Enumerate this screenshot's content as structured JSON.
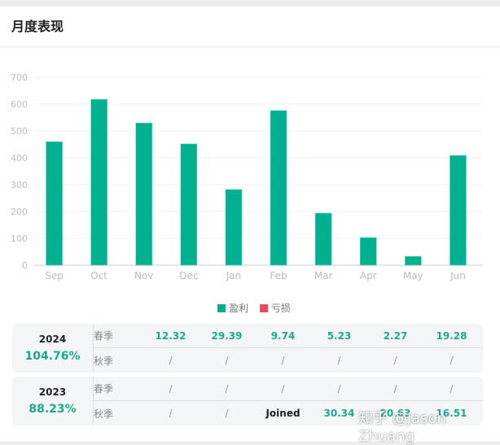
{
  "header": {
    "title": "月度表现"
  },
  "chart_data": {
    "type": "bar",
    "categories": [
      "Sep",
      "Oct",
      "Nov",
      "Dec",
      "Jan",
      "Feb",
      "Mar",
      "Apr",
      "May",
      "Jun"
    ],
    "series": [
      {
        "name": "盈利",
        "color": "#00b08e",
        "values": [
          460,
          618,
          530,
          452,
          282,
          576,
          194,
          103,
          33,
          409
        ]
      },
      {
        "name": "亏损",
        "color": "#e84a5f",
        "values": [
          0,
          0,
          0,
          0,
          0,
          0,
          0,
          0,
          0,
          0
        ]
      }
    ],
    "yticks": [
      "0",
      "100",
      "200",
      "300",
      "400",
      "500",
      "600",
      "700"
    ],
    "ylim": [
      0,
      700
    ],
    "grid": true,
    "legend_position": "bottom"
  },
  "table": [
    {
      "year": "2024",
      "pct": "104.76%",
      "rows": [
        {
          "label": "春季",
          "cells": [
            "12.32",
            "29.39",
            "9.74",
            "5.23",
            "2.27",
            "19.28"
          ]
        },
        {
          "label": "秋季",
          "cells": [
            "/",
            "/",
            "/",
            "/",
            "/",
            "/"
          ]
        }
      ]
    },
    {
      "year": "2023",
      "pct": "88.23%",
      "rows": [
        {
          "label": "春季",
          "cells": [
            "/",
            "/",
            "/",
            "/",
            "/",
            "/"
          ]
        },
        {
          "label": "秋季",
          "cells": [
            "/",
            "/",
            "Joined",
            "30.34",
            "20.63",
            "16.51"
          ]
        }
      ]
    }
  ],
  "watermark": "知乎 @Jason Zhuang"
}
